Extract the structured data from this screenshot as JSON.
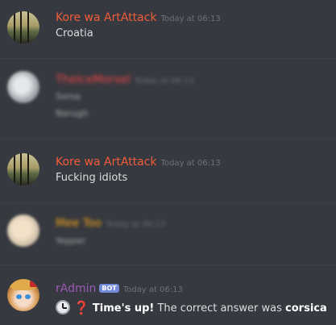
{
  "messages": [
    {
      "author": "Kore wa ArtAttack",
      "timestamp": "Today at 06:13",
      "lines": [
        "Croatia"
      ]
    },
    {
      "author": "TheIceMorsel",
      "timestamp": "Today at 06:13",
      "lines": [
        "Sorsa",
        "Narugh"
      ]
    },
    {
      "author": "Kore wa ArtAttack",
      "timestamp": "Today at 06:13",
      "lines": [
        "Fucking idiots"
      ]
    },
    {
      "author": "Mee Too",
      "timestamp": "Today at 06:13",
      "lines": [
        "Yepper"
      ]
    },
    {
      "author": "rAdmin",
      "bot_tag": "BOT",
      "timestamp": "Today at 06:13",
      "answer": {
        "prefix": "Time's up!",
        "middle": "The correct answer was",
        "answer": "corsica"
      }
    }
  ],
  "icons": {
    "clock": "clock-emoji",
    "question": "question-emoji"
  },
  "colors": {
    "background": "#36393f",
    "username_red": "#f25c3b",
    "username_purple": "#9b59b6",
    "bot_tag": "#7289da"
  }
}
